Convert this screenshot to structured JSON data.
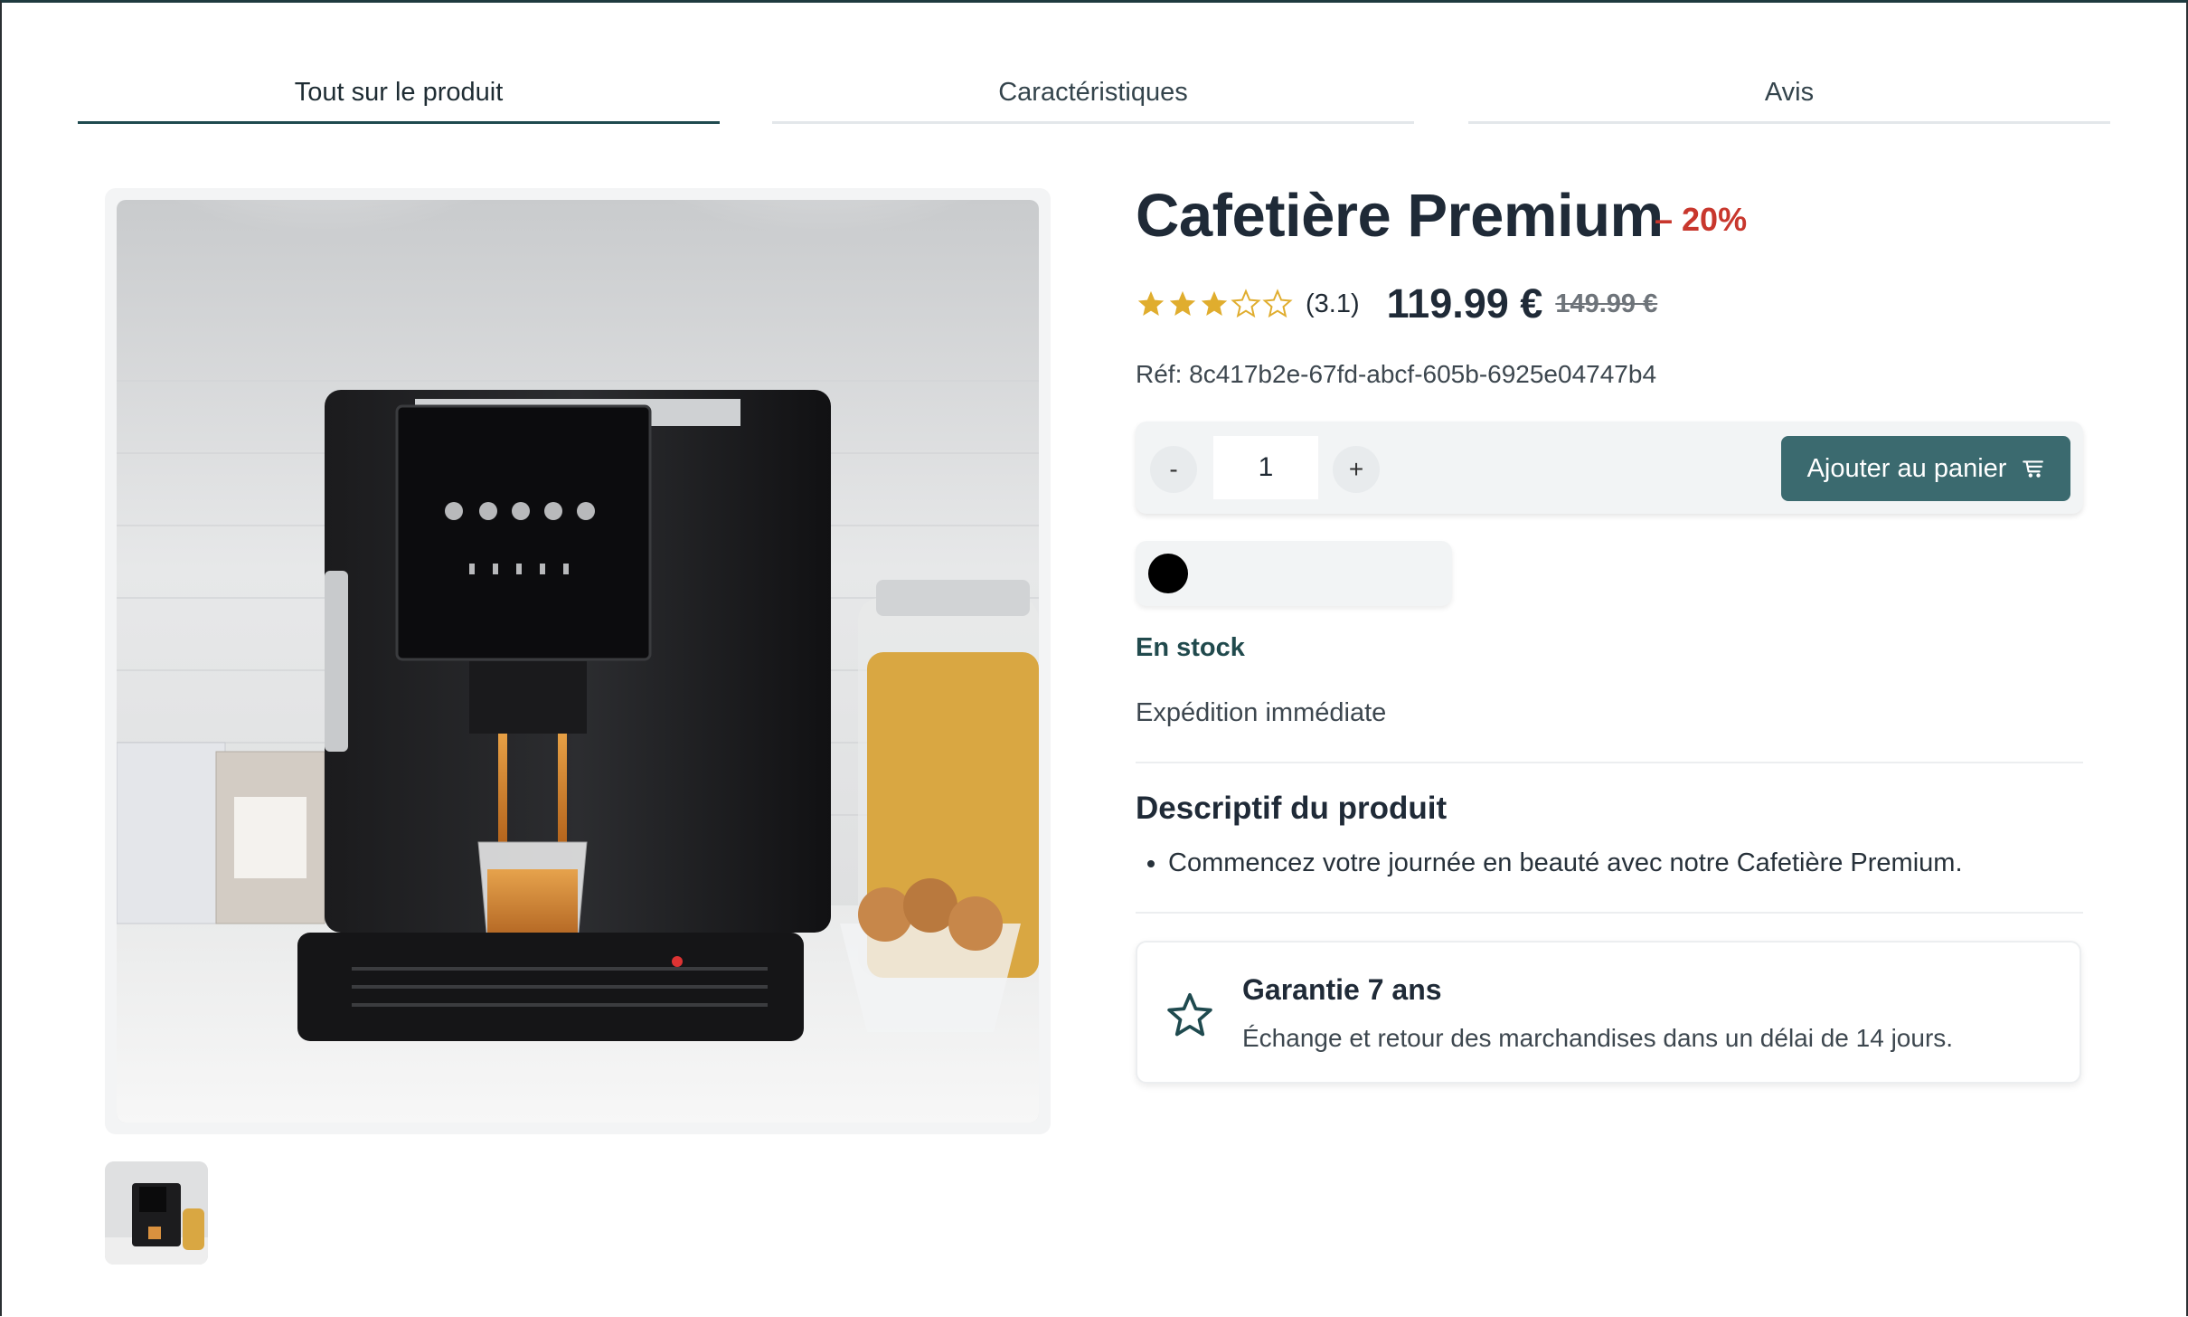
{
  "tabs": [
    {
      "label": "Tout sur le produit",
      "active": true
    },
    {
      "label": "Caractéristiques",
      "active": false
    },
    {
      "label": "Avis",
      "active": false
    }
  ],
  "product": {
    "title": "Cafetière Premium",
    "discount": "– 20%",
    "rating": 3.1,
    "rating_label": "(3.1)",
    "price": "119.99 €",
    "old_price": "149.99 €",
    "reference": "Réf: 8c417b2e-67fd-abcf-605b-6925e04747b4"
  },
  "cart": {
    "decrement_label": "-",
    "quantity": "1",
    "increment_label": "+",
    "add_label": "Ajouter au panier",
    "icon": "cart-icon"
  },
  "colors": [
    {
      "hex": "#000000",
      "selected": true
    }
  ],
  "availability": {
    "stock": "En stock",
    "shipping": "Expédition immédiate"
  },
  "description": {
    "title": "Descriptif du produit",
    "items": [
      "Commencez votre journée en beauté avec notre Cafetière Premium."
    ]
  },
  "warranty": {
    "icon": "star-outline-icon",
    "title": "Garantie 7 ans",
    "text": "Échange et retour des marchandises dans un délai de 14 jours."
  },
  "colors_theme": {
    "accent": "#3b6a6f",
    "discount": "#c8372d",
    "star": "#e0ad2e",
    "stock": "#214a4d"
  }
}
